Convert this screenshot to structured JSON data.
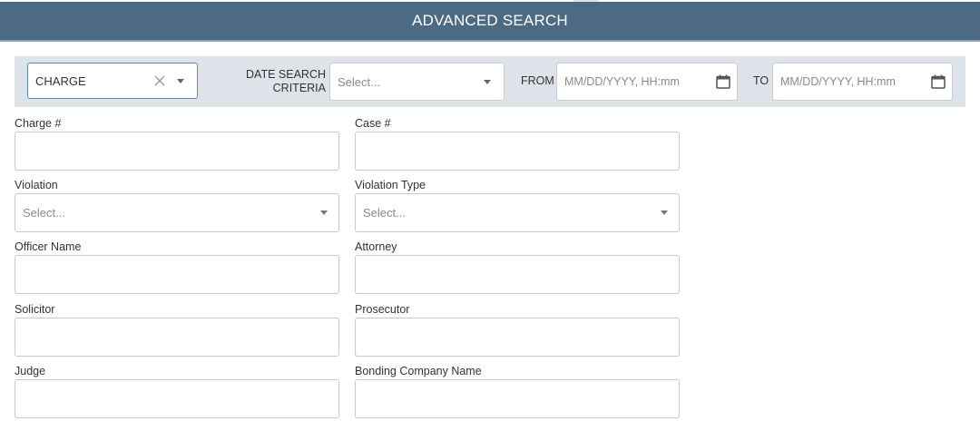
{
  "header": {
    "title": "ADVANCED SEARCH"
  },
  "criteria": {
    "search_type_value": "CHARGE",
    "date_search_label_line1": "DATE SEARCH",
    "date_search_label_line2": "CRITERIA",
    "date_search_placeholder": "Select...",
    "from_label": "FROM",
    "from_placeholder": "MM/DD/YYYY, HH:mm",
    "to_label": "TO",
    "to_placeholder": "MM/DD/YYYY, HH:mm"
  },
  "fields": {
    "charge_number": {
      "label": "Charge #",
      "value": ""
    },
    "case_number": {
      "label": "Case #",
      "value": ""
    },
    "violation": {
      "label": "Violation",
      "placeholder": "Select..."
    },
    "violation_type": {
      "label": "Violation Type",
      "placeholder": "Select..."
    },
    "officer_name": {
      "label": "Officer Name",
      "value": ""
    },
    "attorney": {
      "label": "Attorney",
      "value": ""
    },
    "solicitor": {
      "label": "Solicitor",
      "value": ""
    },
    "prosecutor": {
      "label": "Prosecutor",
      "value": ""
    },
    "judge": {
      "label": "Judge",
      "value": ""
    },
    "bonding_company_name": {
      "label": "Bonding Company Name",
      "value": ""
    }
  },
  "icons": {
    "clear": "close-icon",
    "dropdown": "chevron-down-icon",
    "calendar": "calendar-icon"
  },
  "colors": {
    "header_bg": "#4c6a84",
    "criteria_bg": "#dde3e8",
    "focus_border": "#5d89ad"
  }
}
